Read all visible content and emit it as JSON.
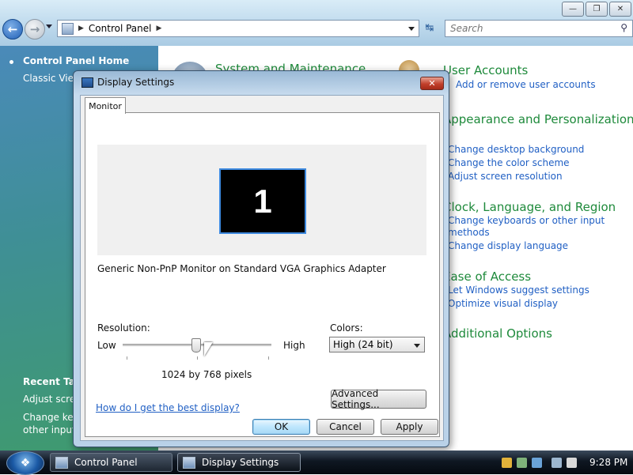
{
  "explorer": {
    "address": {
      "path": "Control Panel"
    },
    "search": {
      "placeholder": "Search"
    }
  },
  "left_pane": {
    "home_label": "Control Panel Home",
    "classic_label": "Classic View",
    "recent_tasks_label": "Recent Tasks",
    "recent_items": [
      "Adjust screen resolution",
      "Change keyboards or other input methods"
    ]
  },
  "main": {
    "categories": [
      {
        "title": "System and Maintenance",
        "links": []
      },
      {
        "title": "User Accounts",
        "links": [
          "Add or remove user accounts"
        ]
      },
      {
        "title": "Appearance and Personalization",
        "links": [
          "Change desktop background",
          "Change the color scheme",
          "Adjust screen resolution"
        ]
      },
      {
        "title": "Clock, Language, and Region",
        "links": [
          "Change keyboards or other input methods",
          "Change display language"
        ]
      },
      {
        "title": "Ease of Access",
        "links": [
          "Let Windows suggest settings",
          "Optimize visual display"
        ]
      },
      {
        "title": "Additional Options",
        "links": []
      }
    ]
  },
  "dialog": {
    "title": "Display Settings",
    "close_label": "✕",
    "tab_label": "Monitor",
    "monitor_number": "1",
    "monitor_description": "Generic Non-PnP Monitor on Standard VGA Graphics Adapter",
    "resolution_label": "Resolution:",
    "low_label": "Low",
    "high_label": "High",
    "resolution_value": "1024 by 768 pixels",
    "resolution_slider_fraction": 0.5,
    "colors_label": "Colors:",
    "colors_selected": "High (24 bit)",
    "help_link": "How do I get the best display?",
    "advanced_button": "Advanced Settings...",
    "ok_button": "OK",
    "cancel_button": "Cancel",
    "apply_button": "Apply"
  },
  "taskbar": {
    "tasks": [
      "Control Panel",
      "Display Settings"
    ],
    "clock": "9:28 PM"
  }
}
